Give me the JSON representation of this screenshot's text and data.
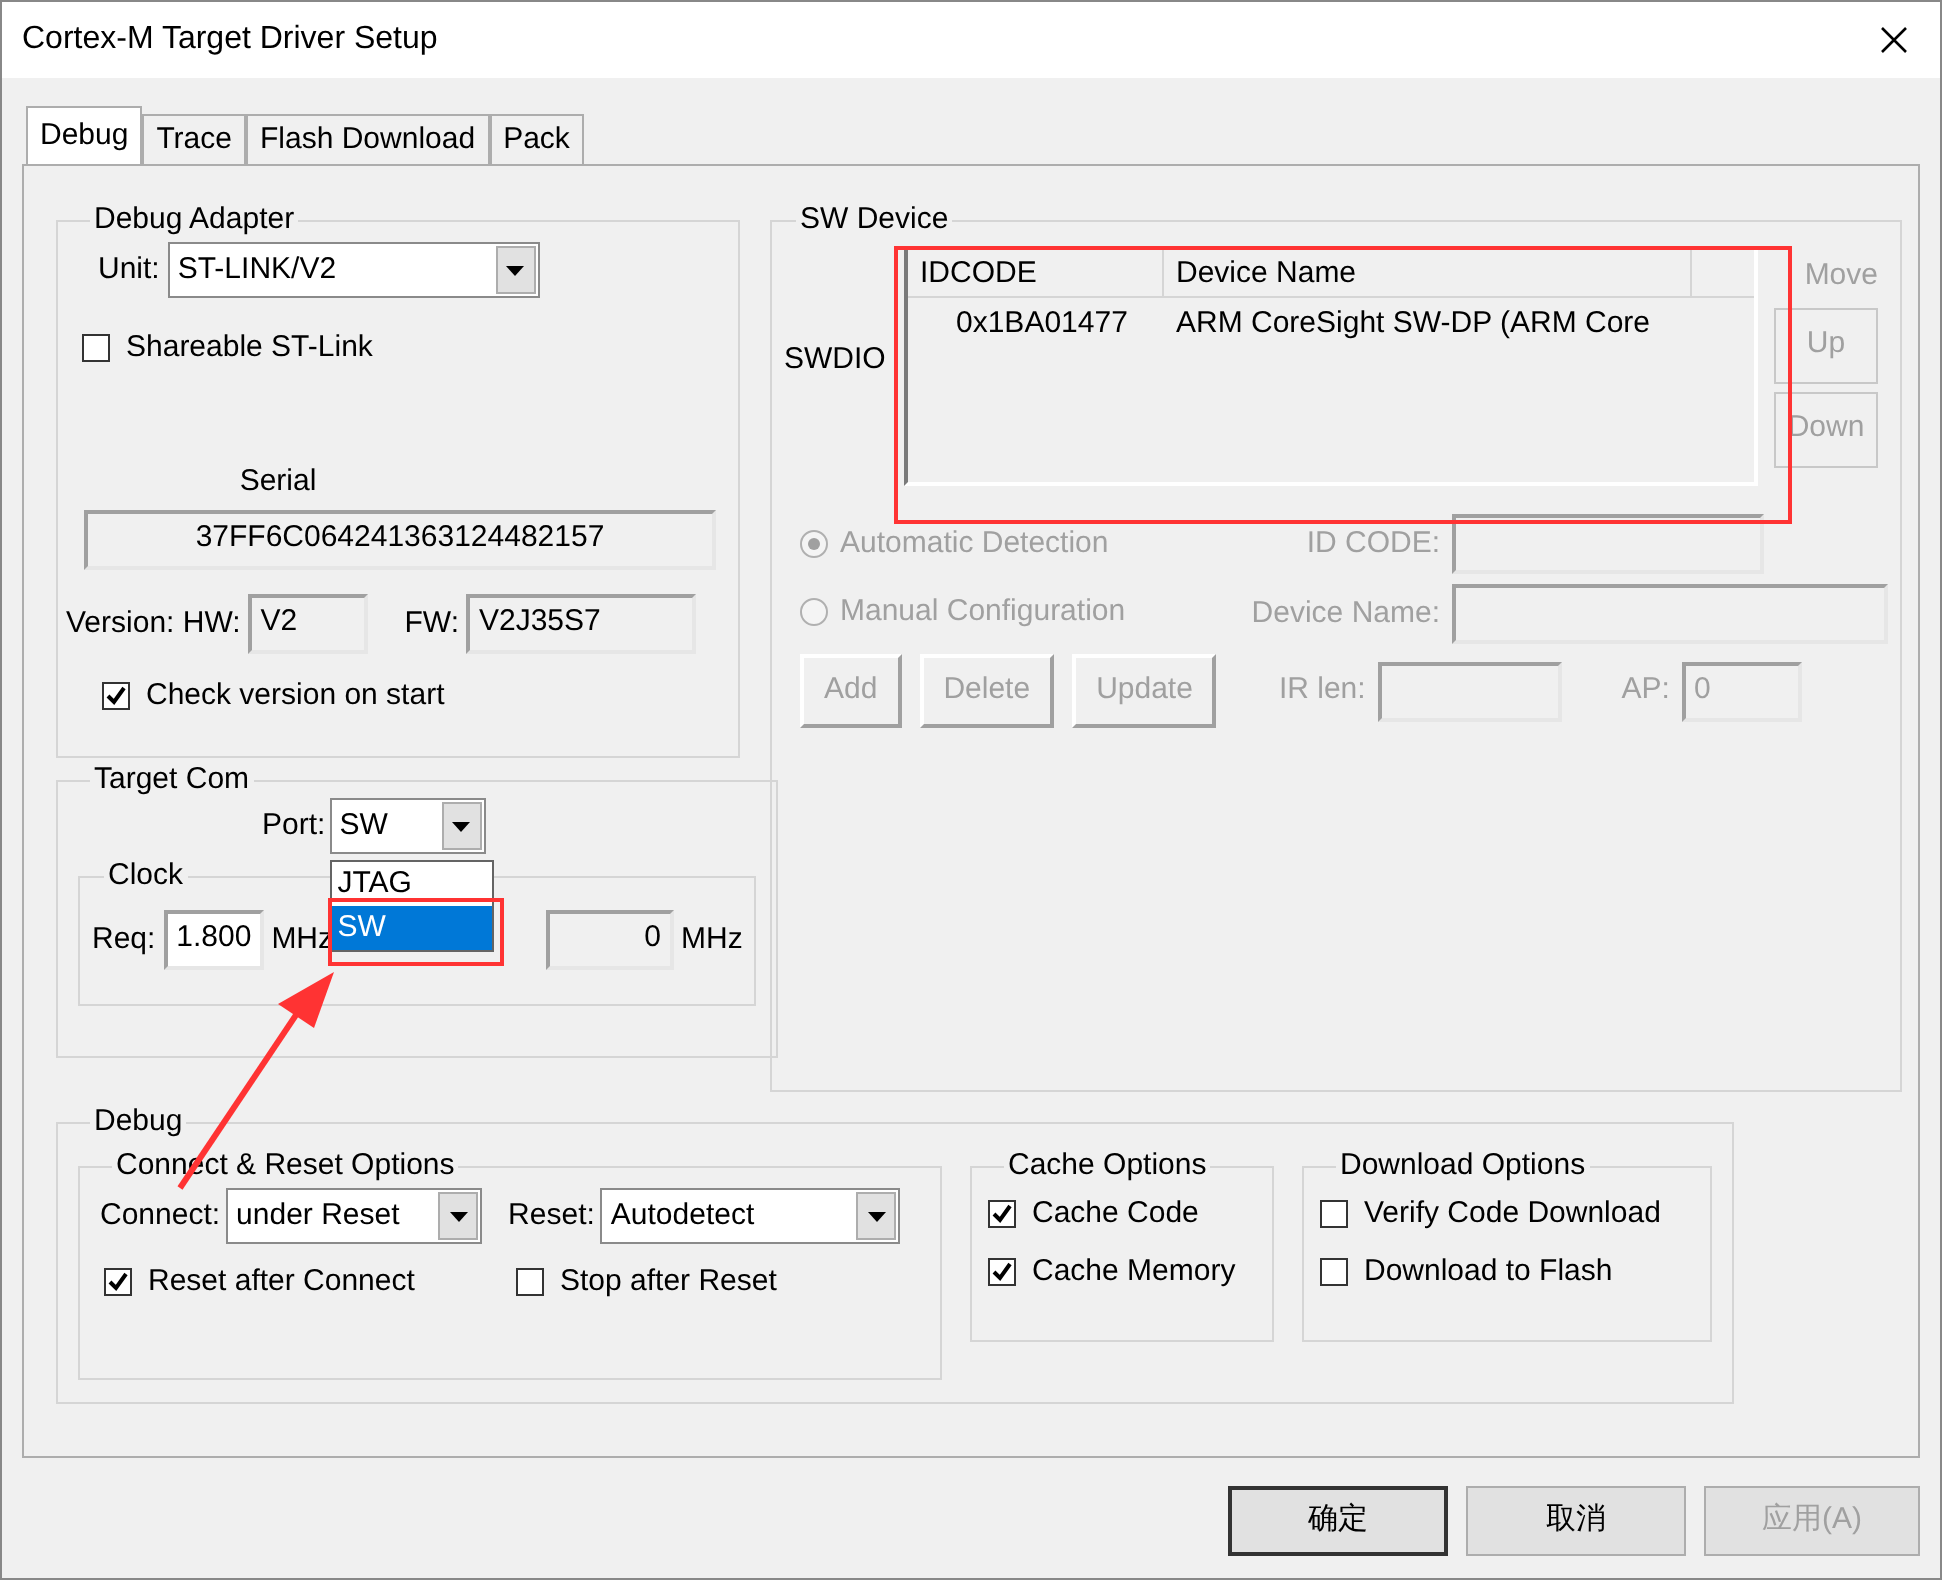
{
  "window": {
    "title": "Cortex-M Target Driver Setup"
  },
  "tabs": [
    {
      "label": "Debug",
      "selected": true
    },
    {
      "label": "Trace",
      "selected": false
    },
    {
      "label": "Flash Download",
      "selected": false
    },
    {
      "label": "Pack",
      "selected": false
    }
  ],
  "debug_adapter": {
    "title": "Debug Adapter",
    "unit_label": "Unit:",
    "unit": "ST-LINK/V2",
    "shareable": {
      "label": "Shareable ST-Link",
      "checked": false
    },
    "serial_label": "Serial",
    "serial": "37FF6C064241363124482157",
    "version_label": "Version: HW:",
    "hw": "V2",
    "fw_label": "FW:",
    "fw": "V2J35S7",
    "check_version": {
      "label": "Check version on start",
      "checked": true
    }
  },
  "target_com": {
    "title": "Target Com",
    "port_label": "Port:",
    "port": "SW",
    "port_options": [
      {
        "label": "JTAG",
        "selected": false
      },
      {
        "label": "SW",
        "selected": true
      }
    ],
    "clock": {
      "title": "Clock",
      "req_label": "Req:",
      "req": "1.800",
      "req_unit": "MHz",
      "selected_value": "0",
      "selected_unit": "MHz"
    }
  },
  "sw_device": {
    "title": "SW Device",
    "row_label": "SWDIO",
    "columns": [
      "IDCODE",
      "Device Name"
    ],
    "rows": [
      [
        "0x1BA01477",
        "ARM CoreSight SW-DP (ARM Core"
      ]
    ],
    "move": {
      "label": "Move",
      "disabled": true,
      "buttons": [
        "Up",
        "Down"
      ]
    },
    "config": {
      "disabled": true,
      "detection": [
        {
          "label": "Automatic Detection",
          "selected": true
        },
        {
          "label": "Manual Configuration",
          "selected": false
        }
      ],
      "id_code_label": "ID CODE:",
      "device_name_label": "Device Name:",
      "buttons": [
        "Add",
        "Delete",
        "Update"
      ],
      "ir_len_label": "IR len:",
      "ap_label": "AP:",
      "ap": "0"
    }
  },
  "debug": {
    "title": "Debug",
    "connect_reset": {
      "title": "Connect & Reset Options",
      "connect_label": "Connect:",
      "connect": "under Reset",
      "reset_label": "Reset:",
      "reset": "Autodetect",
      "options": [
        {
          "label": "Reset after Connect",
          "checked": true
        },
        {
          "label": "Stop after Reset",
          "checked": false
        }
      ]
    },
    "cache": {
      "title": "Cache Options",
      "options": [
        {
          "label": "Cache Code",
          "checked": true
        },
        {
          "label": "Cache Memory",
          "checked": true
        }
      ]
    },
    "download": {
      "title": "Download Options",
      "options": [
        {
          "label": "Verify Code Download",
          "checked": false
        },
        {
          "label": "Download to Flash",
          "checked": false
        }
      ]
    }
  },
  "buttons": [
    {
      "label": "确定",
      "default": true,
      "disabled": false
    },
    {
      "label": "取消",
      "default": false,
      "disabled": false
    },
    {
      "label": "应用(A)",
      "default": false,
      "disabled": true
    }
  ]
}
